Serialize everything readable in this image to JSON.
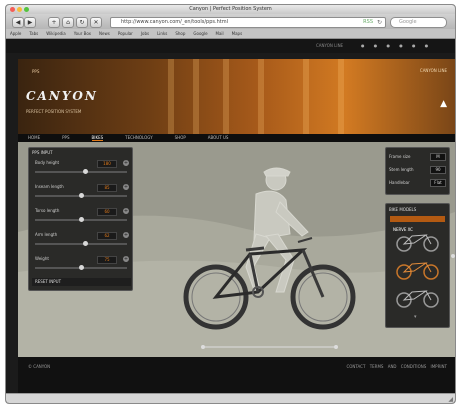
{
  "window": {
    "title": "Canyon | Perfect Position System"
  },
  "toolbar": {
    "back": "◀",
    "forward": "▶",
    "url": "http://www.canyon.com/_en/tools/pps.html",
    "search_placeholder": "Google"
  },
  "bookmarks": [
    "Apple",
    "Tabs",
    "Wikipedia",
    "Your Box",
    "News",
    "Popular",
    "Jobs",
    "Links",
    "Shop",
    "Google",
    "Mail",
    "Maps"
  ],
  "site": {
    "brand": "CANYON",
    "banner_tag": "PPS",
    "banner_sub": "PERFECT POSITION SYSTEM",
    "top_links": "CANYON LINE",
    "subnav": [
      "HOME",
      "PPS",
      "BIKES",
      "TECHNOLOGY",
      "SHOP",
      "ABOUT US"
    ],
    "active_subnav_index": 2
  },
  "left_panel": {
    "title": "PPS INPUT",
    "fields": [
      {
        "label": "Body height",
        "value": "180",
        "level": 0.55
      },
      {
        "label": "Inseam length",
        "value": "85",
        "level": 0.5
      },
      {
        "label": "Torso length",
        "value": "60",
        "level": 0.5
      },
      {
        "label": "Arm length",
        "value": "62",
        "level": 0.55
      },
      {
        "label": "Weight",
        "value": "75",
        "level": 0.5
      }
    ],
    "footer": "RESET INPUT"
  },
  "right_panel_top": {
    "rows": [
      {
        "label": "Frame size",
        "value": "M"
      },
      {
        "label": "Stem length",
        "value": "90"
      },
      {
        "label": "Handlebar",
        "value": "Flat"
      }
    ]
  },
  "right_panel_bikes": {
    "title": "BIKE MODELS",
    "highlight": "NERVE XC",
    "bikes": [
      "nerve",
      "torque",
      "grand canyon"
    ]
  },
  "footer": {
    "left": "© CANYON",
    "right": "CONTACT  TERMS AND CONDITIONS  IMPRINT"
  },
  "colors": {
    "accent": "#e07a1a",
    "stage": "#9a9a8e",
    "panel": "#2a2a28"
  }
}
